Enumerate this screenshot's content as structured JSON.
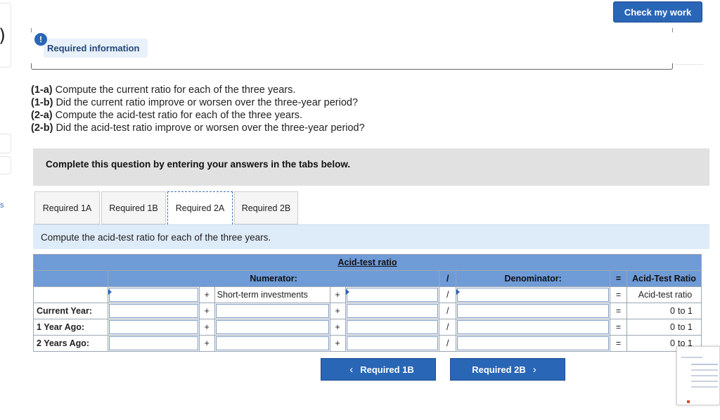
{
  "top": {
    "check_button": "Check my work"
  },
  "info": {
    "icon": "!",
    "label": "Required information"
  },
  "questions": [
    {
      "tag": "(1-a)",
      "text": " Compute the current ratio for each of the three years."
    },
    {
      "tag": "(1-b)",
      "text": " Did the current ratio improve or worsen over the three-year period?"
    },
    {
      "tag": "(2-a)",
      "text": " Compute the acid-test ratio for each of the three years."
    },
    {
      "tag": "(2-b)",
      "text": " Did the acid-test ratio improve or worsen over the three-year period?"
    }
  ],
  "banner": "Complete this question by entering your answers in the tabs below.",
  "tabs": [
    {
      "label": "Required 1A"
    },
    {
      "label": "Required 1B"
    },
    {
      "label": "Required 2A"
    },
    {
      "label": "Required 2B"
    }
  ],
  "instruction": "Compute the acid-test ratio for each of the three years.",
  "table": {
    "title": "Acid-test ratio",
    "numerator_header": "Numerator:",
    "slash": "/",
    "denominator_header": "Denominator:",
    "equals": "=",
    "result_header": "Acid-Test Ratio",
    "plus": "+",
    "label_row": {
      "second_item": "Short-term investments",
      "result": "Acid-test ratio"
    },
    "rows": [
      {
        "label": "Current Year:",
        "value": "0",
        "unit": "to 1"
      },
      {
        "label": "1 Year Ago:",
        "value": "0",
        "unit": "to 1"
      },
      {
        "label": "2 Years Ago:",
        "value": "0",
        "unit": "to 1"
      }
    ]
  },
  "nav": {
    "prev": "Required 1B",
    "next": "Required 2B",
    "prev_icon": "‹",
    "next_icon": "›"
  },
  "left_edge": {
    "paren": ")",
    "fragment": "s"
  }
}
